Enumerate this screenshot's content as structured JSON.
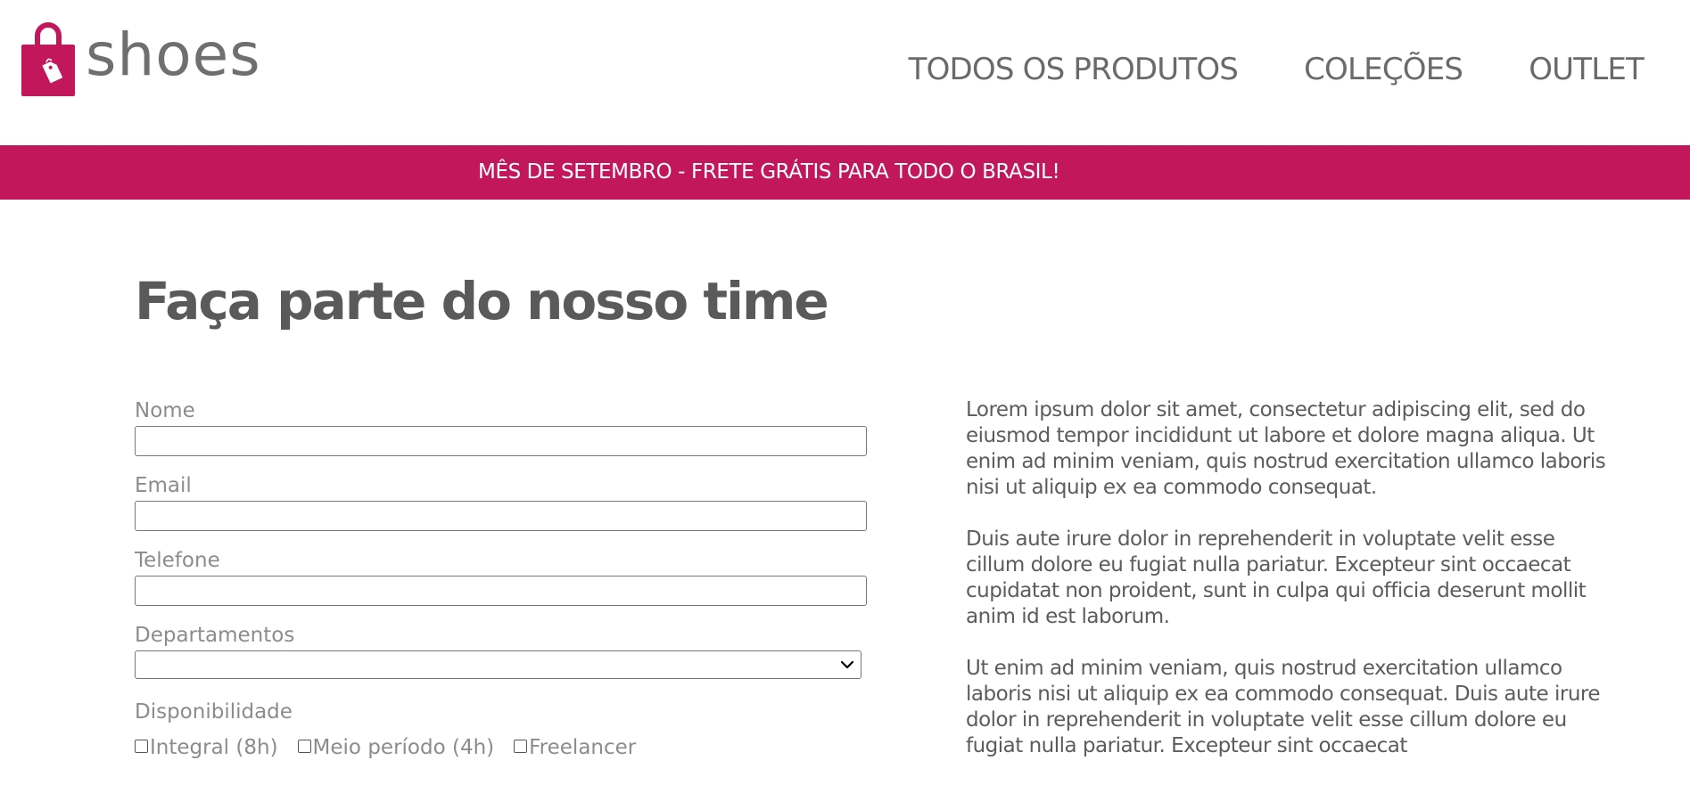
{
  "brand": {
    "name": "shoes",
    "accent_color": "#c2185b",
    "logo_icon": "shopping-bag-tag-icon"
  },
  "nav": {
    "items": [
      {
        "label": "TODOS OS PRODUTOS"
      },
      {
        "label": "COLEÇÕES"
      },
      {
        "label": "OUTLET"
      }
    ]
  },
  "banner": {
    "text": "MÊS DE SETEMBRO - FRETE GRÁTIS PARA TODO O BRASIL!"
  },
  "page": {
    "title": "Faça parte do nosso time"
  },
  "form": {
    "name_label": "Nome",
    "name_value": "",
    "email_label": "Email",
    "email_value": "",
    "phone_label": "Telefone",
    "phone_value": "",
    "department_label": "Departamentos",
    "department_selected": "",
    "availability_label": "Disponibilidade",
    "availability_options": [
      {
        "label": "Integral (8h)",
        "checked": false
      },
      {
        "label": "Meio período (4h)",
        "checked": false
      },
      {
        "label": "Freelancer",
        "checked": false
      }
    ]
  },
  "content": {
    "paragraphs": [
      "Lorem ipsum dolor sit amet, consectetur adipiscing elit, sed do eiusmod tempor incididunt ut labore et dolore magna aliqua. Ut enim ad minim veniam, quis nostrud exercitation ullamco laboris nisi ut aliquip ex ea commodo consequat.",
      "Duis aute irure dolor in reprehenderit in voluptate velit esse cillum dolore eu fugiat nulla pariatur. Excepteur sint occaecat cupidatat non proident, sunt in culpa qui officia deserunt mollit anim id est laborum.",
      "Ut enim ad minim veniam, quis nostrud exercitation ullamco laboris nisi ut aliquip ex ea commodo consequat. Duis aute irure dolor in reprehenderit in voluptate velit esse cillum dolore eu fugiat nulla pariatur. Excepteur sint occaecat"
    ]
  }
}
